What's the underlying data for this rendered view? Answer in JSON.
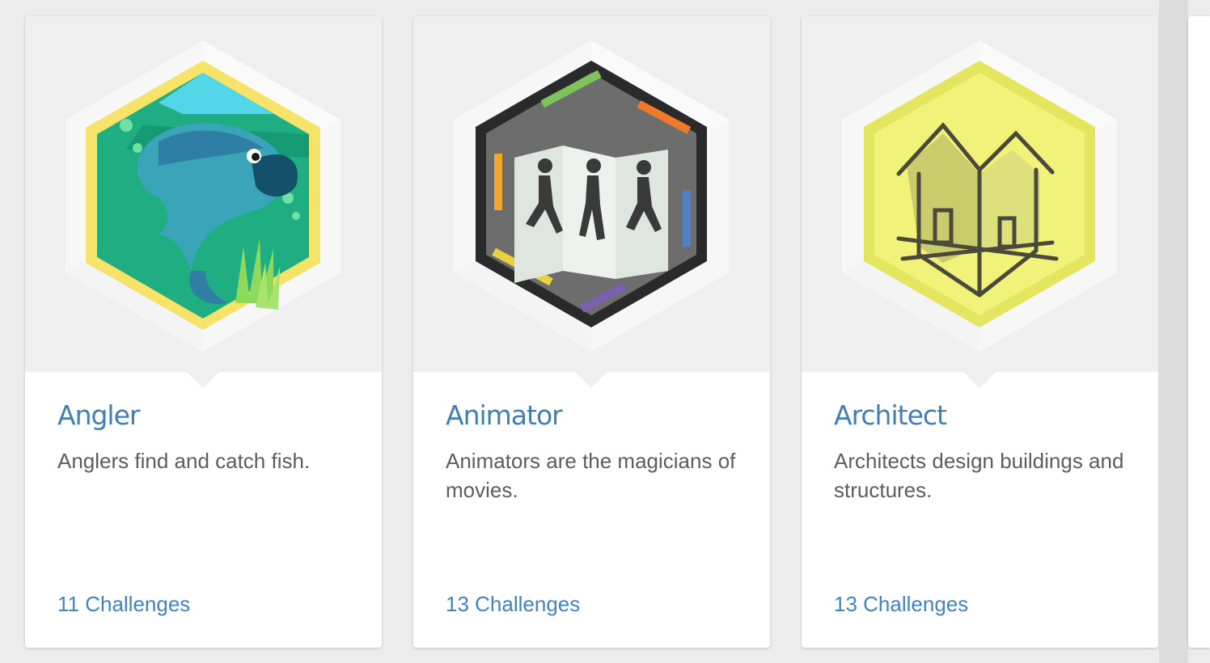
{
  "colors": {
    "title": "#3f7fb5",
    "link": "#3f84c1",
    "description": "#5d5d5d",
    "card_background": "#ffffff",
    "badge_area": "#efefef",
    "page_background": "#ececec"
  },
  "cards": [
    {
      "title": "Angler",
      "description": "Anglers find and catch fish.",
      "challenges": "11 Challenges",
      "icon": "fish-icon",
      "badge_colors": {
        "rim": "#f5e36a",
        "fill": "#1fae82",
        "accent": "#2e7fa3"
      }
    },
    {
      "title": "Animator",
      "description": "Animators are the magicians of movies.",
      "challenges": "13 Challenges",
      "icon": "animation-figures-icon",
      "badge_colors": {
        "rim": "#2a2a2a",
        "fill": "#6d6d6d",
        "accent": "#dfe6e0"
      }
    },
    {
      "title": "Architect",
      "description": "Architects design buildings and structures.",
      "challenges": "13 Challenges",
      "icon": "house-blueprint-icon",
      "badge_colors": {
        "rim": "#e4e65f",
        "fill": "#f0f27a",
        "accent": "#4a4a3a"
      }
    }
  ]
}
